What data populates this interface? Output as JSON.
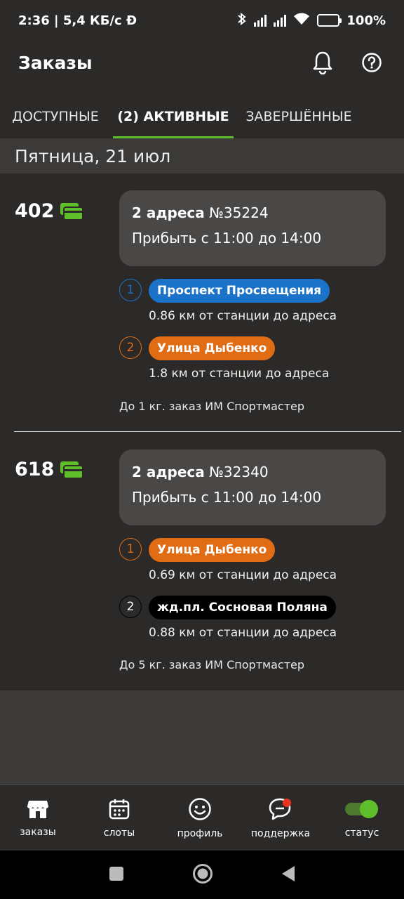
{
  "status_bar": {
    "time_speed": "2:36 | 5,4 КБ/с Ð",
    "battery": "100%"
  },
  "app_bar": {
    "title": "Заказы",
    "icons": [
      "bell-icon",
      "help-icon"
    ]
  },
  "tabs": [
    {
      "label": "ДОСТУПНЫЕ",
      "active": false
    },
    {
      "label": "(2) АКТИВНЫЕ",
      "active": true
    },
    {
      "label": "ЗАВЕРШЁННЫЕ",
      "active": false
    }
  ],
  "date_header": "Пятница, 21 июл",
  "orders": [
    {
      "price": "402",
      "addresses_label": "2 адреса",
      "order_number": "№35224",
      "arrive": "Прибыть с 11:00 до 14:00",
      "stops": [
        {
          "num": "1",
          "name": "Проспект Просвещения",
          "distance": "0.86 км от станции до адреса",
          "color": "#1a73c8"
        },
        {
          "num": "2",
          "name": "Улица Дыбенко",
          "distance": "1.8 км от станции до адреса",
          "color": "#e06c14"
        }
      ],
      "note": "До 1 кг. заказ ИМ Спортмастер"
    },
    {
      "price": "618",
      "addresses_label": "2 адреса",
      "order_number": "№32340",
      "arrive": "Прибыть с 11:00 до 14:00",
      "stops": [
        {
          "num": "1",
          "name": "Улица Дыбенко",
          "distance": "0.69 км от станции до адреса",
          "color": "#e06c14"
        },
        {
          "num": "2",
          "name": "жд.пл. Сосновая Поляна",
          "distance": "0.88 км от станции до адреса",
          "color": "#000000"
        }
      ],
      "note": "До 5 кг. заказ ИМ Спортмастер"
    }
  ],
  "bottom_nav": [
    {
      "label": "заказы",
      "icon": "store-icon"
    },
    {
      "label": "слоты",
      "icon": "calendar-icon"
    },
    {
      "label": "профиль",
      "icon": "smiley-icon"
    },
    {
      "label": "поддержка",
      "icon": "chat-icon"
    },
    {
      "label": "статус",
      "icon": "toggle-icon",
      "on": true
    }
  ],
  "colors": {
    "accent": "#5fbf2a",
    "background": "#2c2a29",
    "card": "#4a4847"
  }
}
